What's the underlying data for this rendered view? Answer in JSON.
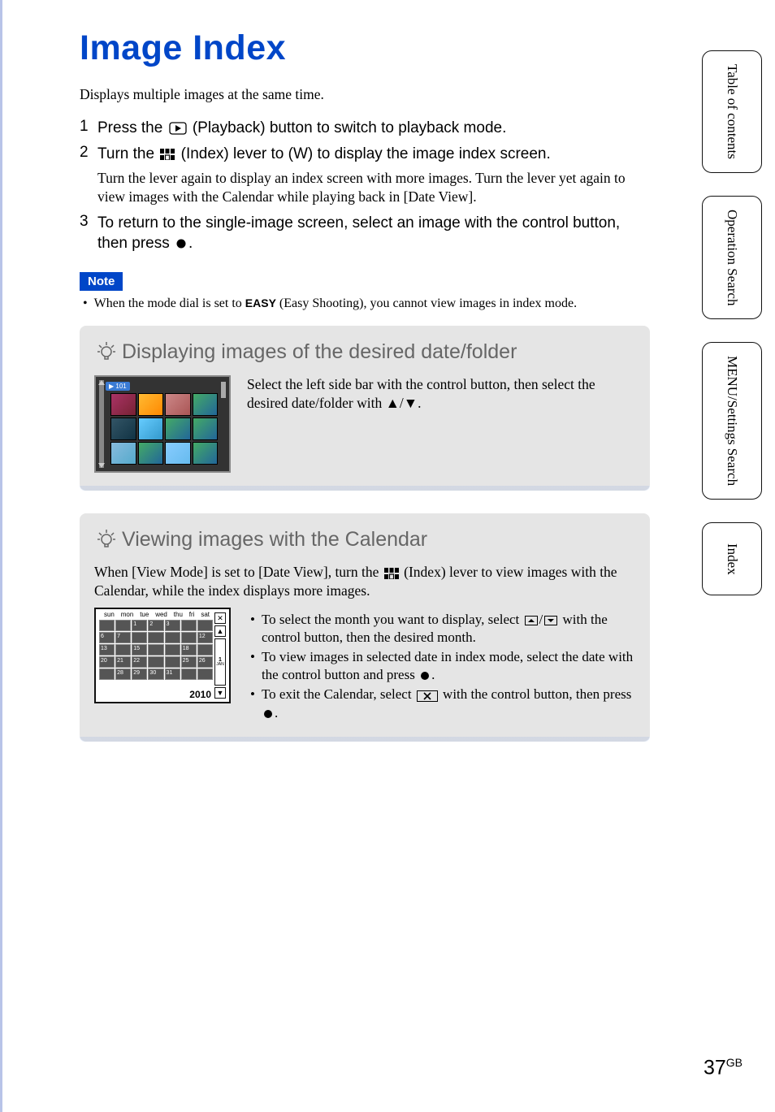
{
  "title": "Image Index",
  "intro": "Displays multiple images at the same time.",
  "steps": [
    {
      "num": "1",
      "text_pre": "Press the ",
      "text_post": " (Playback) button to switch to playback mode."
    },
    {
      "num": "2",
      "text_pre": "Turn the ",
      "text_post": " (Index) lever to (W) to display the image index screen.",
      "sub": "Turn the lever again to display an index screen with more images. Turn the lever yet again to view images with the Calendar while playing back in [Date View]."
    },
    {
      "num": "3",
      "text_pre": "To return to the single-image screen, select an image with the control button, then press ",
      "text_post": "."
    }
  ],
  "note_label": "Note",
  "note_text_pre": "When the mode dial is set to ",
  "note_easy": "EASY",
  "note_text_post": " (Easy Shooting), you cannot view images in index mode.",
  "tip1": {
    "title": "Displaying images of the desired date/folder",
    "body": "Select the left side bar with the control button, then select the desired date/folder with ▲/▼.",
    "badge": "▶ 101"
  },
  "tip2": {
    "title": "Viewing images with the Calendar",
    "intro_pre": "When [View Mode] is set to [Date View], turn the ",
    "intro_post": " (Index) lever to view images with the Calendar, while the index displays more images.",
    "bullets": [
      {
        "pre": "To select the month you want to display, select ",
        "mid": "/",
        "post": " with the control button, then the desired month."
      },
      {
        "pre": "To view images in selected date in index mode, select the date with the control button and press ",
        "post": "."
      },
      {
        "pre": "To exit the Calendar, select ",
        "post": " with the control button, then press "
      }
    ],
    "cal": {
      "days": [
        "sun",
        "mon",
        "tue",
        "wed",
        "thu",
        "fri",
        "sat"
      ],
      "cells": [
        "",
        "",
        "1",
        "2",
        "3",
        "",
        "",
        "6",
        "7",
        "",
        "",
        "",
        "",
        "12",
        "13",
        "",
        "15",
        "",
        "",
        "18",
        "",
        "20",
        "21",
        "22",
        "",
        "",
        "25",
        "26",
        "",
        "28",
        "29",
        "30",
        "31",
        "",
        ""
      ],
      "year": "2010",
      "jan": "1",
      "jan_label": "JAN"
    }
  },
  "side_tabs": [
    "Table of contents",
    "Operation Search",
    "MENU/Settings Search",
    "Index"
  ],
  "page_num": "37",
  "page_suffix": "GB"
}
